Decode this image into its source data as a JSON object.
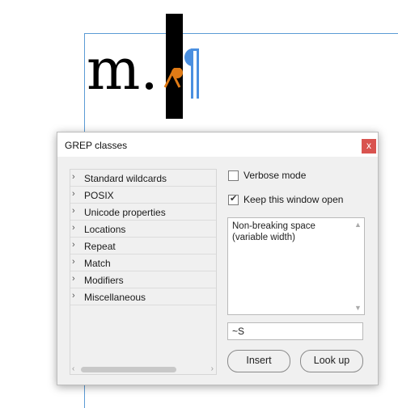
{
  "document": {
    "sample_text": "m."
  },
  "dialog": {
    "title": "GREP classes",
    "close_label": "x",
    "tree_items": [
      {
        "label": "Standard wildcards"
      },
      {
        "label": "POSIX"
      },
      {
        "label": "Unicode properties"
      },
      {
        "label": "Locations"
      },
      {
        "label": "Repeat"
      },
      {
        "label": "Match"
      },
      {
        "label": "Modifiers"
      },
      {
        "label": "Miscellaneous"
      }
    ],
    "verbose_mode": {
      "label": "Verbose mode",
      "checked": false
    },
    "keep_open": {
      "label": "Keep this window open",
      "checked": true
    },
    "description": "Non-breaking space (variable width)",
    "code_value": "~S",
    "insert_label": "Insert",
    "lookup_label": "Look up"
  },
  "colors": {
    "guide": "#5b9bd5",
    "close_button": "#d9534f",
    "orange_mark": "#e07b16",
    "pilcrow": "#4a8fe0"
  }
}
